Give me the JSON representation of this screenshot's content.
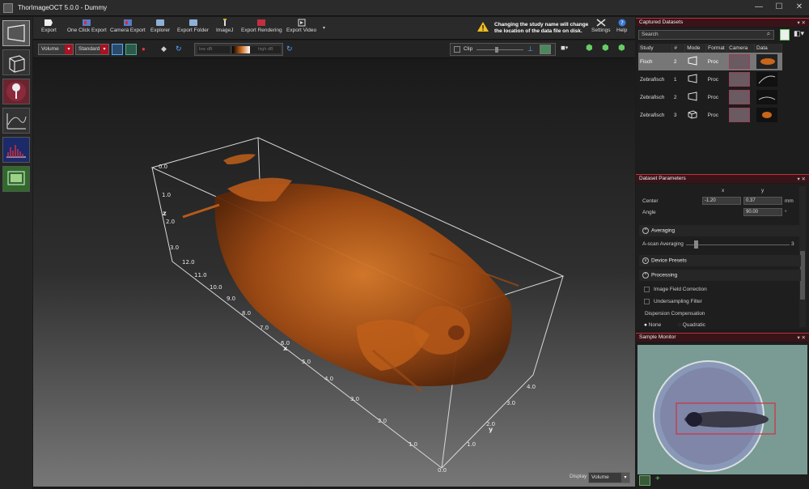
{
  "window": {
    "title": "ThorImageOCT 5.0.0 - Dummy"
  },
  "toolbar": {
    "buttons": [
      {
        "label": "Export"
      },
      {
        "label": "One Click Export"
      },
      {
        "label": "Camera Export"
      },
      {
        "label": "Explorer"
      },
      {
        "label": "Export Folder"
      },
      {
        "label": "ImageJ"
      },
      {
        "label": "Export Rendering"
      },
      {
        "label": "Export Video"
      }
    ],
    "warning": "Changing the study name will change the location of the data file on disk.",
    "settings_label": "Settings",
    "help_label": "Help"
  },
  "view_toolbar": {
    "mode_value": "Volume",
    "preset_value": "Standard",
    "low_db": "low dB",
    "high_db": "high dB",
    "clip_label": "Clip"
  },
  "axes": {
    "z_label": "z",
    "x_label": "x",
    "y_label": "y",
    "z_ticks": [
      "0.0",
      "1.0",
      "2.0",
      "3.0"
    ],
    "x_ticks": [
      "12.0",
      "11.0",
      "10.0",
      "9.0",
      "8.0",
      "7.0",
      "6.0",
      "5.0",
      "4.0",
      "3.0",
      "2.0",
      "1.0",
      "0.0"
    ],
    "y_ticks": [
      "4.0",
      "3.0",
      "2.0",
      "1.0"
    ]
  },
  "display": {
    "label": "Display",
    "value": "Volume"
  },
  "captured_datasets": {
    "title": "Captured Datasets",
    "search_placeholder": "Search",
    "columns": [
      "Study",
      "#",
      "Mode",
      "Format",
      "Camera",
      "Data"
    ],
    "rows": [
      {
        "study": "Fisch",
        "num": "2",
        "format": "Proc",
        "selected": true
      },
      {
        "study": "Zebrafisch",
        "num": "1",
        "format": "Proc",
        "selected": false
      },
      {
        "study": "Zebrafisch",
        "num": "2",
        "format": "Proc",
        "selected": false
      },
      {
        "study": "Zebrafisch",
        "num": "3",
        "format": "Proc",
        "selected": false
      }
    ]
  },
  "dataset_parameters": {
    "title": "Dataset Parameters",
    "col_x": "x",
    "col_y": "y",
    "center_label": "Center",
    "center_x": "-1.20",
    "center_y": "0.37",
    "center_unit": "mm",
    "angle_label": "Angle",
    "angle_value": "90.00",
    "angle_unit": "°",
    "averaging_label": "Averaging",
    "ascan_label": "A-scan Averaging",
    "ascan_value": "3",
    "device_presets_label": "Device Presets",
    "processing_label": "Processing",
    "image_field_label": "Image Field Correction",
    "undersampling_label": "Undersampling Filter",
    "dispersion_label": "Dispersion Compensation",
    "none_label": "None",
    "quadratic_label": "Quadratic"
  },
  "sample_monitor": {
    "title": "Sample Monitor"
  },
  "colors": {
    "accent": "#c0303a",
    "volume": "#c8661a"
  }
}
